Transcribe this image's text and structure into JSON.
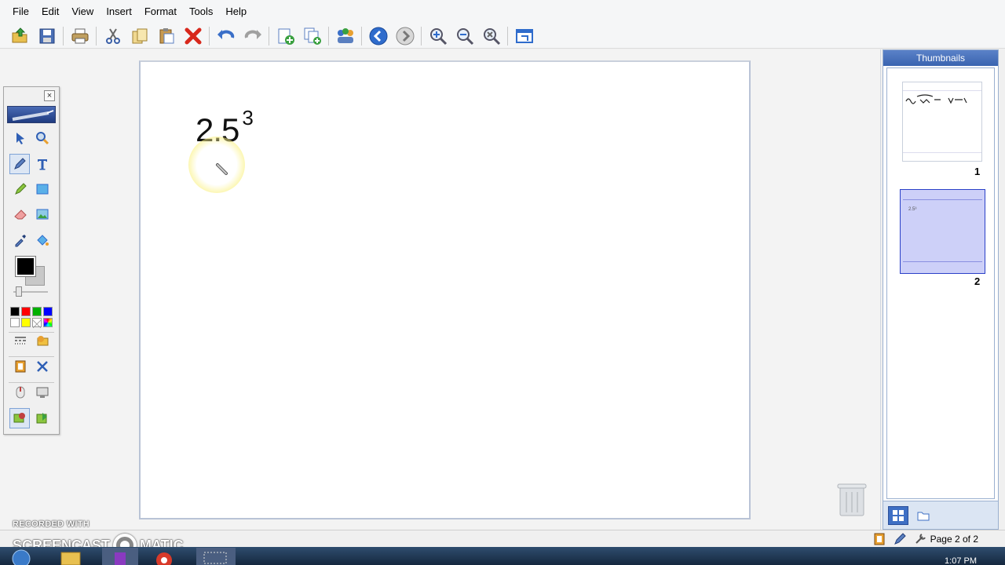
{
  "menu": {
    "file": "File",
    "edit": "Edit",
    "view": "View",
    "insert": "Insert",
    "format": "Format",
    "tools": "Tools",
    "help": "Help"
  },
  "toolbar_icons": [
    "open-icon",
    "save-icon",
    "print-icon",
    "cut-icon",
    "copy-icon",
    "paste-icon",
    "delete-icon",
    "undo-icon",
    "redo-icon",
    "add-page-icon",
    "duplicate-page-icon",
    "share-icon",
    "previous-page-icon",
    "next-page-icon",
    "zoom-in-icon",
    "zoom-out-icon",
    "zoom-fit-icon",
    "full-screen-icon"
  ],
  "page": {
    "expression_base": "2.5",
    "expression_exponent": "3"
  },
  "palette": {
    "close_label": "×",
    "foreground_color": "#000000",
    "background_color": "#c8c8c8",
    "colors": [
      "#000000",
      "#ff0000",
      "#00b000",
      "#0000ff",
      "#ffffff",
      "#ffff00",
      "#ffffff",
      "#8080ff"
    ]
  },
  "thumbnails": {
    "title": "Thumbnails",
    "pages": [
      {
        "number": "1"
      },
      {
        "number": "2",
        "mini_text": "2.5³"
      }
    ]
  },
  "status": {
    "page_info": "Page 2 of 2"
  },
  "watermark": {
    "top": "RECORDED WITH",
    "left": "SCREENCAST",
    "right": "MATIC"
  },
  "taskbar": {
    "clock": "1:07 PM"
  }
}
